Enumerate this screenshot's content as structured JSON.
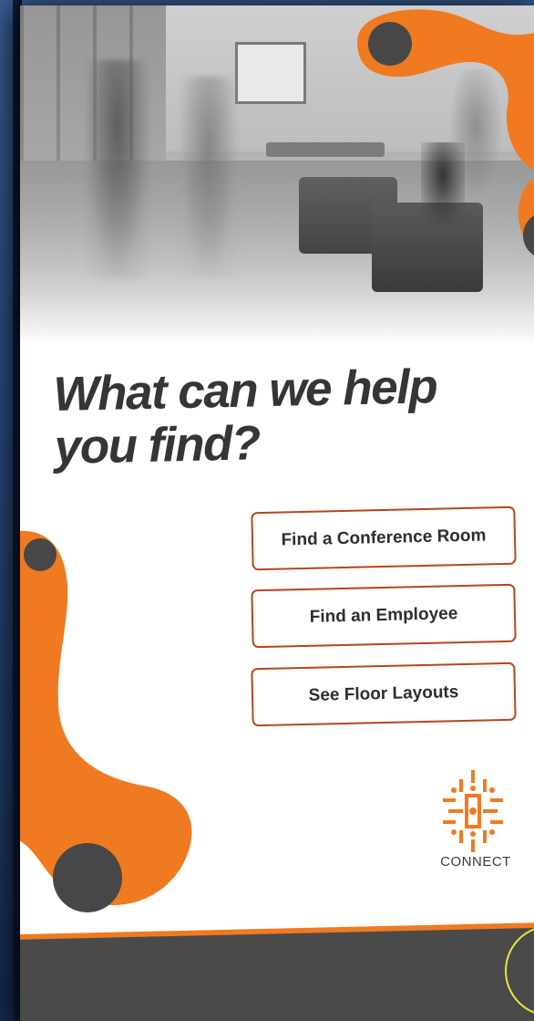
{
  "headline": {
    "line1": "What can we help",
    "line2": "you find?"
  },
  "buttons": [
    {
      "label": "Find a Conference Room"
    },
    {
      "label": "Find an Employee"
    },
    {
      "label": "See Floor Layouts"
    }
  ],
  "logo": {
    "text": "CONNECT",
    "icon": "connect-logo-icon"
  },
  "colors": {
    "accent": "#f07a21",
    "button_border": "#b5461e",
    "headline": "#353535",
    "dark": "#4a4a4a",
    "ring": "#e8e83a"
  }
}
